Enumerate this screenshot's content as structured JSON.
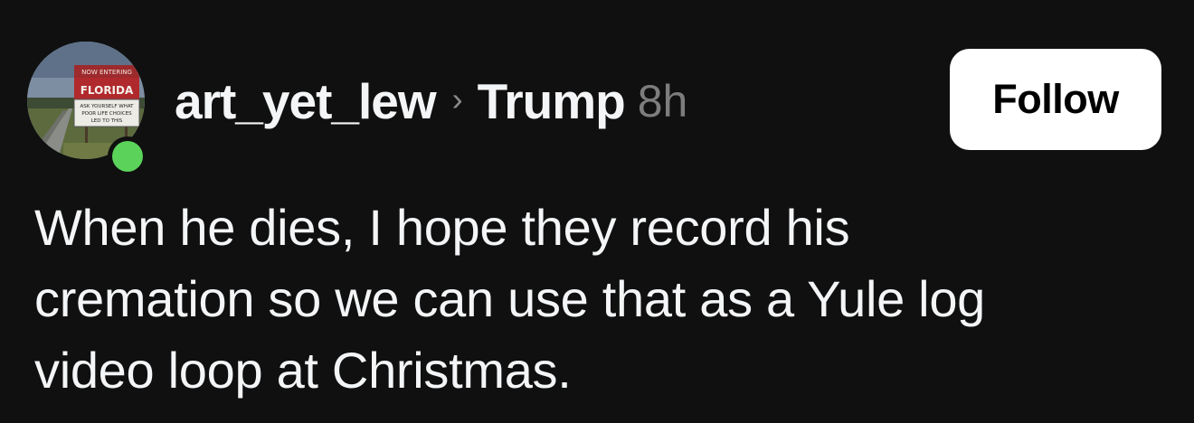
{
  "post": {
    "author": {
      "username": "art_yet_lew",
      "avatar_icon": "road-sign-photo",
      "avatar_sign_text": [
        "NOW ENTERING",
        "FLORIDA",
        "ASK YOURSELF WHAT",
        "POOR LIFE CHOICES",
        "LED TO THIS"
      ],
      "online": true,
      "online_color": "#5bd35b"
    },
    "separator_icon": "chevron-right-icon",
    "separator": "›",
    "topic": "Trump",
    "time": "8h",
    "follow_label": "Follow",
    "body_lines": [
      "When he dies, I hope they record his",
      "cremation so we can use that as a Yule log",
      "video loop at Christmas."
    ]
  },
  "colors": {
    "background": "#101010",
    "text_primary": "#f3f5f7",
    "text_secondary": "#7d7d7d",
    "button_bg": "#ffffff",
    "button_text": "#000000"
  }
}
